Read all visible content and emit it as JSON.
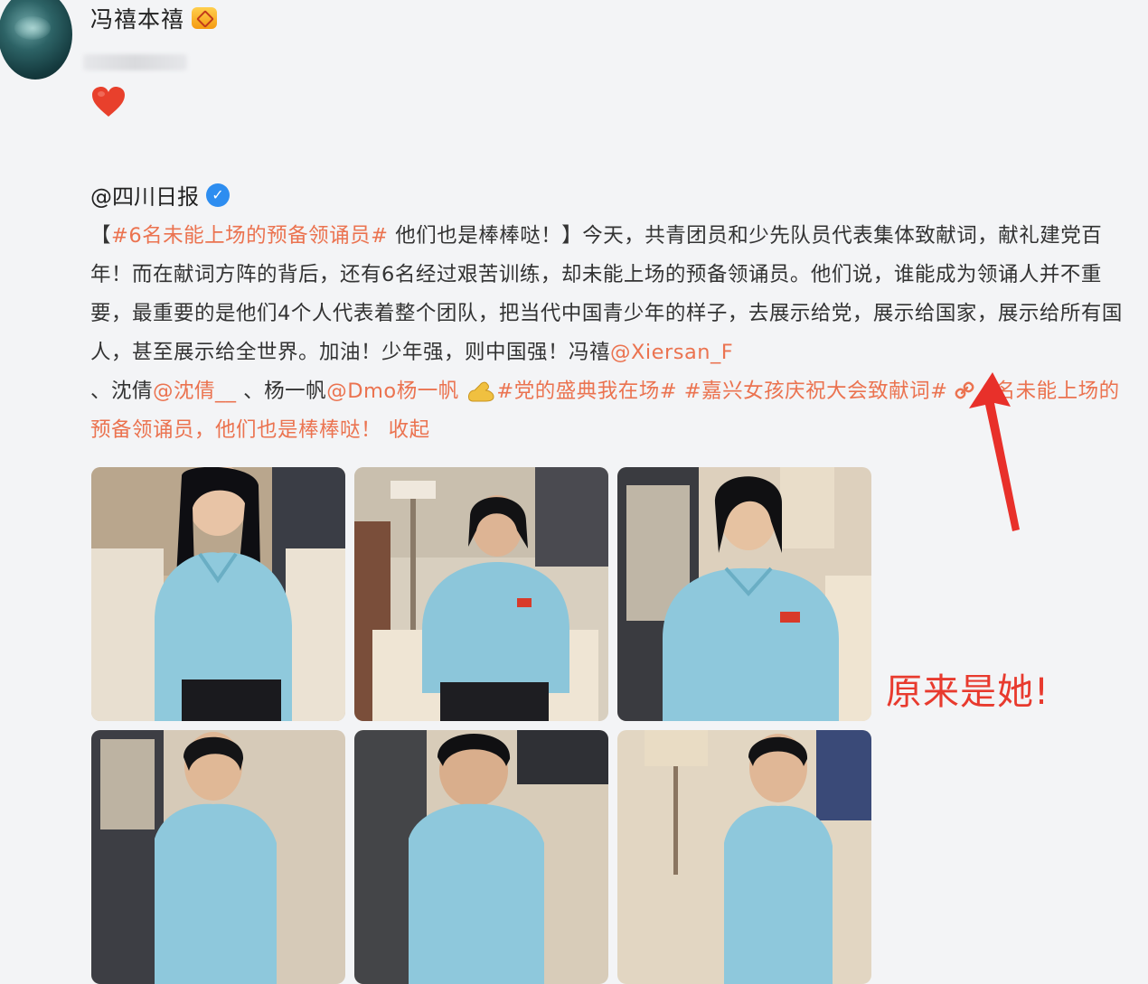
{
  "user": {
    "name": "冯禧本禧",
    "badge_icon": "vip-crown-icon",
    "reaction_icon": "heart-icon"
  },
  "repost": {
    "source": "@四川日报",
    "verified_icon": "verified-check-icon",
    "text": {
      "open_bracket": "【",
      "headline_tag": "#6名未能上场的预备领诵员#",
      "headline_rest": " 他们也是棒棒哒！】今天，共青团员和少先队员代表集体致献词，献礼建党百年！而在献词方阵的背后，还有6名经过艰苦训练，却未能上场的预备领诵员。他们说，谁能成为领诵人并不重要，最重要的是他们4个人代表着整个团队，把当代中国青少年的样子，去展示给党，展示给国家，展示给所有国人，甚至展示给全世界。加油！少年强，则中国强！冯禧",
      "mention_1": "@Xiersan_F",
      "sep_1": "、沈倩",
      "mention_2": "@沈倩__",
      "sep_2": " 、杨一帆",
      "mention_3": "@Dmo杨一帆",
      "emoji_icon": "muscle-emoji-icon",
      "tag_2": "#党的盛典我在场#",
      "tag_3": "#嘉兴女孩庆祝大会致献词#",
      "link_icon": "link-chain-icon",
      "link_text": "6名未能上场的预备领诵员，他们也是棒棒哒！",
      "collapse": "收起"
    }
  },
  "photos": [
    {
      "name": "photo-1"
    },
    {
      "name": "photo-2"
    },
    {
      "name": "photo-3"
    },
    {
      "name": "photo-4"
    },
    {
      "name": "photo-5"
    },
    {
      "name": "photo-6"
    }
  ],
  "overlay": {
    "arrow_icon": "red-arrow-icon",
    "annotation": "原来是她!",
    "annotation_color": "#e83a2e"
  },
  "colors": {
    "accent": "#eb7350",
    "verified": "#2d8df0"
  }
}
